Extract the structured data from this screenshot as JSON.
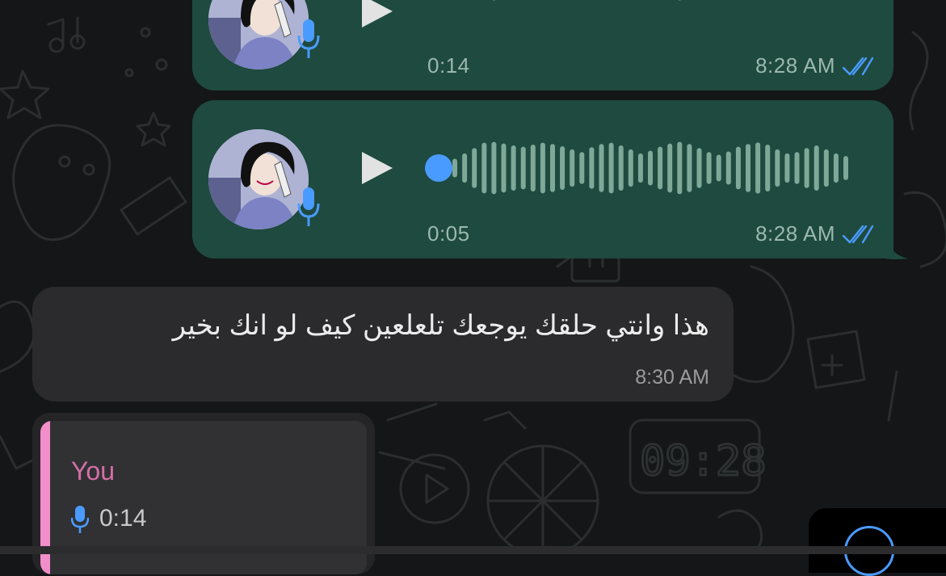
{
  "colors": {
    "background": "#141617",
    "outgoing_bubble": "#1e4a3f",
    "incoming_bubble": "#2b2b2d",
    "read_ticks": "#4a9bff",
    "play_dot": "#4a9bff",
    "reply_accent": "#f28fcb",
    "reply_sender": "#d46fa6"
  },
  "messages": {
    "voice1": {
      "type": "voice",
      "direction": "outgoing",
      "duration": "0:14",
      "time": "8:28 AM",
      "status": "read",
      "progress": 0
    },
    "voice2": {
      "type": "voice",
      "direction": "outgoing",
      "duration": "0:05",
      "time": "8:28 AM",
      "status": "read",
      "progress": 0
    },
    "text1": {
      "type": "text",
      "direction": "incoming",
      "text": "هذا وانتي حلقك يوجعك تلعلعين كيف لو انك بخير",
      "time": "8:30 AM"
    },
    "reply": {
      "direction": "incoming",
      "sender": "You",
      "quoted_type": "voice",
      "quoted_duration": "0:14"
    }
  },
  "icons": {
    "play": "play-icon",
    "mic": "microphone-icon",
    "ticks": "double-check-icon",
    "fab": "circle-action-icon"
  }
}
